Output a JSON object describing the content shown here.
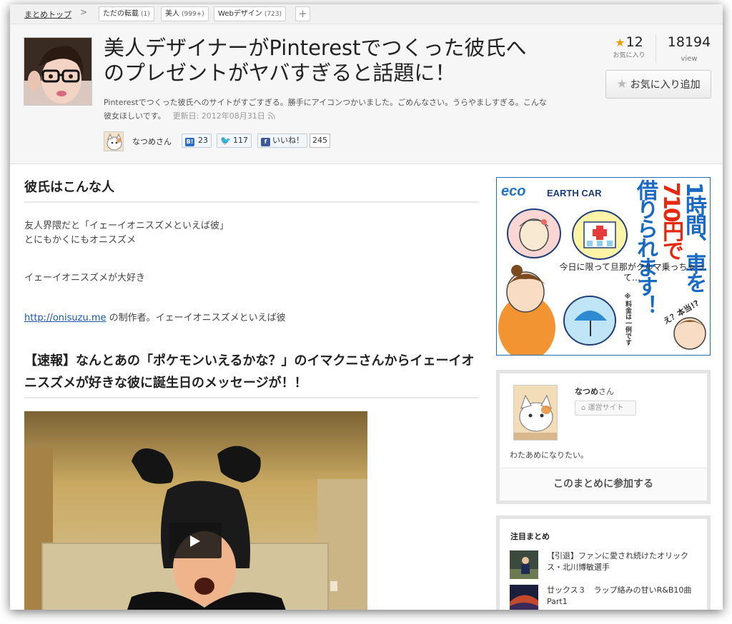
{
  "breadcrumb": {
    "top": "まとめトップ",
    "separator": ">",
    "tags": [
      {
        "label": "ただの転載",
        "count": "(1)"
      },
      {
        "label": "美人",
        "count": "(999+)"
      },
      {
        "label": "Webデザイン",
        "count": "(723)"
      }
    ],
    "add": "+"
  },
  "header": {
    "title": "美人デザイナーがPinterestでつくった彼氏へのプレゼントがヤバすぎると話題に！",
    "description": "Pinterestでつくった彼氏へのサイトがすごすぎる。勝手にアイコンつかいました。ごめんなさい。うらやましすぎる。こんな彼女ほしいです。",
    "updated": "更新日: 2012年08月31日",
    "author": "なつめさん",
    "hatena_label": "B!",
    "hatena_count": "23",
    "tweet_count": "117",
    "facebook_label": "いいね！",
    "facebook_count": "245",
    "favorites": "12",
    "favorites_label": "お気に入り",
    "views": "18194",
    "views_label": "view",
    "fav_add_button": "お気に入り追加"
  },
  "main": {
    "heading1": "彼氏はこんな人",
    "para1_line1": "友人界隈だと「イェーイオニスズメといえば彼」",
    "para1_line2": "とにもかくにもオニスズメ",
    "para2": "イェーイオニスズメが大好き",
    "link": "http://onisuzu.me",
    "para3_rest": " の制作者。イェーイオニスズメといえば彼",
    "heading2": "【速報】なんとあの「ポケモンいえるかな？」のイマクニさんからイェーイオニスズメが好きな彼に誕生日のメッセージが！！"
  },
  "ad": {
    "eco": "eco",
    "brand": "EARTH CAR",
    "col1": "1時間、車を",
    "col2": "710円で",
    "col3": "借りられます！",
    "note": "※料金は一例です",
    "speech": "今日に限って旦那がクルマ乗っちゃって…",
    "aside": "え？本当!?"
  },
  "sidebar": {
    "author_name": "なつめ",
    "author_suffix": "さん",
    "site_button": "運営サイト",
    "bio": "わたあめになりたい。",
    "join_button": "このまとめに参加する",
    "topics_title": "注目まとめ",
    "topics": [
      {
        "title": "【引退】ファンに愛され続けたオリックス・北川博敏選手"
      },
      {
        "title": "廿ックス３　ラップ絡みの甘いR&B10曲Part1"
      }
    ]
  }
}
